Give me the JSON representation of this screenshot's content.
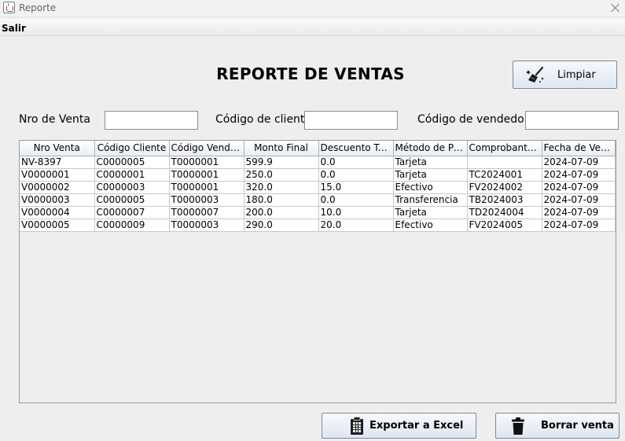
{
  "window": {
    "title": "Reporte"
  },
  "menubar": {
    "items": [
      "Salir"
    ]
  },
  "header": {
    "title": "REPORTE DE VENTAS"
  },
  "buttons": {
    "clear": {
      "label": "Limpiar",
      "icon": "broom-icon"
    },
    "export": {
      "label": "Exportar a Excel",
      "icon": "spreadsheet-icon"
    },
    "delete": {
      "label": "Borrar venta",
      "icon": "trash-icon"
    }
  },
  "filters": {
    "sale_number": {
      "label": "Nro de Venta",
      "value": ""
    },
    "client_code": {
      "label": "Código de cliente",
      "value": ""
    },
    "seller_code": {
      "label": "Código de vendedor",
      "value": ""
    }
  },
  "table": {
    "columns": [
      "Nro Venta",
      "Código Cliente",
      "Código Vende...",
      "Monto Final",
      "Descuento Total",
      "Método de Pago",
      "Comprobante ...",
      "Fecha de Venta"
    ],
    "rows": [
      [
        "NV-8397",
        "C0000005",
        "T0000001",
        "599.9",
        "0.0",
        "Tarjeta",
        "",
        "2024-07-09"
      ],
      [
        "V0000001",
        "C0000001",
        "T0000001",
        "250.0",
        "0.0",
        "Tarjeta",
        "TC2024001",
        "2024-07-09"
      ],
      [
        "V0000002",
        "C0000003",
        "T0000001",
        "320.0",
        "15.0",
        "Efectivo",
        "FV2024002",
        "2024-07-09"
      ],
      [
        "V0000003",
        "C0000005",
        "T0000003",
        "180.0",
        "0.0",
        "Transferencia",
        "TB2024003",
        "2024-07-09"
      ],
      [
        "V0000004",
        "C0000007",
        "T0000007",
        "200.0",
        "10.0",
        "Tarjeta",
        "TD2024004",
        "2024-07-09"
      ],
      [
        "V0000005",
        "C0000009",
        "T0000003",
        "290.0",
        "20.0",
        "Efectivo",
        "FV2024005",
        "2024-07-09"
      ]
    ]
  }
}
